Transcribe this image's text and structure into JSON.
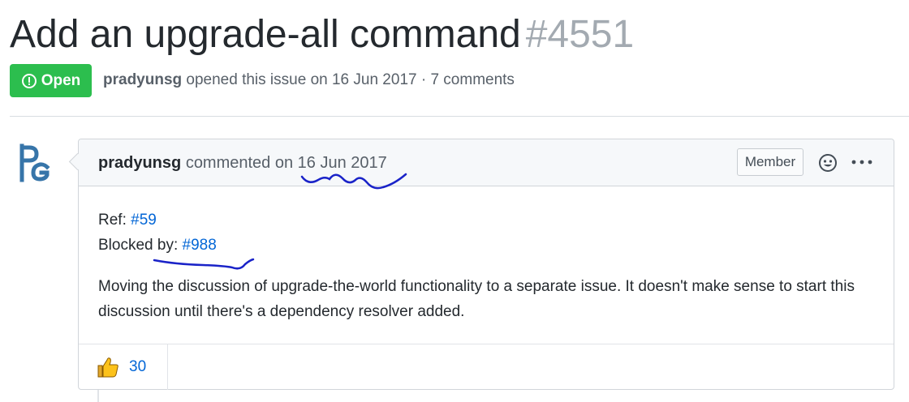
{
  "issue": {
    "title": "Add an upgrade-all command",
    "number": "#4551",
    "state": "Open",
    "author": "pradyunsg",
    "opened_text": "opened this issue on 16 Jun 2017 · 7 comments"
  },
  "comment": {
    "author": "pradyunsg",
    "action": "commented on",
    "date": "16 Jun 2017",
    "role_label": "Member",
    "ref_label": "Ref:",
    "ref_link": "#59",
    "blocked_label": "Blocked by:",
    "blocked_link": "#988",
    "body": "Moving the discussion of upgrade-the-world functionality to a separate issue. It doesn't make sense to start this discussion until there's a dependency resolver added.",
    "reaction": {
      "icon": "thumbs-up-icon",
      "count": "30"
    }
  },
  "colors": {
    "open_green": "#2cbe4e",
    "link_blue": "#0366d6",
    "avatar_blue": "#3775a9",
    "annotation_blue": "#1a23c8"
  }
}
